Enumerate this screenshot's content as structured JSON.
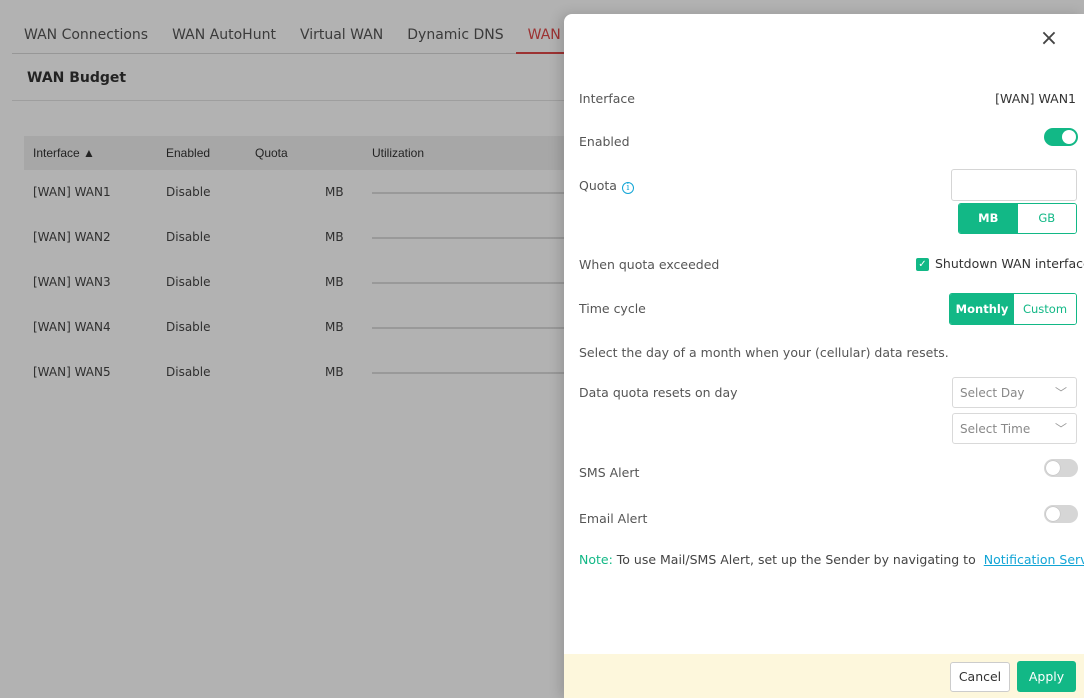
{
  "tabs": [
    "WAN Connections",
    "WAN AutoHunt",
    "Virtual WAN",
    "Dynamic DNS",
    "WAN Budget"
  ],
  "section_title": "WAN Budget",
  "table": {
    "headers": {
      "interface": "Interface ▲",
      "enabled": "Enabled",
      "quota": "Quota",
      "utilization": "Utilization"
    },
    "rows": [
      {
        "interface": "[WAN] WAN1",
        "enabled": "Disable",
        "unit": "MB"
      },
      {
        "interface": "[WAN] WAN2",
        "enabled": "Disable",
        "unit": "MB"
      },
      {
        "interface": "[WAN] WAN3",
        "enabled": "Disable",
        "unit": "MB"
      },
      {
        "interface": "[WAN] WAN4",
        "enabled": "Disable",
        "unit": "MB"
      },
      {
        "interface": "[WAN] WAN5",
        "enabled": "Disable",
        "unit": "MB"
      }
    ]
  },
  "drawer": {
    "close_icon": "×",
    "interface_label": "Interface",
    "interface_value": "[WAN] WAN1",
    "enabled_label": "Enabled",
    "enabled_on": true,
    "quota_label": "Quota",
    "quota_info_icon": "i",
    "quota_value": "",
    "unit_options": [
      "MB",
      "GB"
    ],
    "unit_selected": "MB",
    "exceeded_label": "When quota exceeded",
    "shutdown_checked": true,
    "shutdown_label": "Shutdown WAN interface",
    "checkmark": "✓",
    "cycle_label": "Time cycle",
    "cycle_options": [
      "Monthly",
      "Custom"
    ],
    "cycle_selected": "Monthly",
    "reset_hint": "Select the day of a month when your (cellular) data resets.",
    "reset_label": "Data quota resets on day",
    "select_day_placeholder": "Select Day",
    "select_time_placeholder": "Select Time",
    "chevron": "﹀",
    "sms_label": "SMS Alert",
    "sms_on": false,
    "email_label": "Email Alert",
    "email_on": false,
    "note_label": "Note:",
    "note_text": " To use Mail/SMS Alert, set up the Sender by navigating to",
    "note_link": "Notification Services",
    "cancel_label": "Cancel",
    "apply_label": "Apply"
  },
  "colors": {
    "accent": "#12b886",
    "active_tab": "#e04848",
    "link": "#12a5d6",
    "footer_bg": "#fdf7dc"
  }
}
